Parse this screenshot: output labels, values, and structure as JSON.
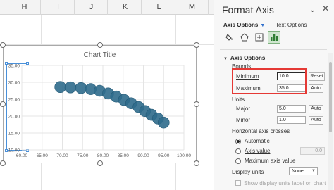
{
  "sheet": {
    "columns": [
      "H",
      "I",
      "J",
      "K",
      "L",
      "M"
    ]
  },
  "chart": {
    "title": "Chart Title"
  },
  "chart_data": {
    "type": "scatter",
    "title": "Chart Title",
    "xlabel": "",
    "ylabel": "",
    "xlim": [
      60,
      100
    ],
    "ylim": [
      10,
      35
    ],
    "x_ticks": [
      "60.00",
      "65.00",
      "70.00",
      "75.00",
      "80.00",
      "85.00",
      "90.00",
      "95.00",
      "100.00"
    ],
    "y_ticks": [
      "10.00",
      "15.00",
      "20.00",
      "25.00",
      "30.00",
      "35.00"
    ],
    "grid": true,
    "marker_color": "#2f6b8c",
    "points": [
      {
        "x": 69.5,
        "y": 28.6
      },
      {
        "x": 72.0,
        "y": 28.5
      },
      {
        "x": 74.6,
        "y": 28.3
      },
      {
        "x": 77.0,
        "y": 28.0
      },
      {
        "x": 79.2,
        "y": 27.5
      },
      {
        "x": 81.3,
        "y": 26.7
      },
      {
        "x": 83.3,
        "y": 25.8
      },
      {
        "x": 85.2,
        "y": 24.8
      },
      {
        "x": 87.0,
        "y": 23.8
      },
      {
        "x": 88.8,
        "y": 22.7
      },
      {
        "x": 90.4,
        "y": 21.5
      },
      {
        "x": 92.0,
        "y": 20.4
      },
      {
        "x": 93.6,
        "y": 19.3
      },
      {
        "x": 95.0,
        "y": 18.1
      }
    ]
  },
  "pane": {
    "title": "Format Axis",
    "tabs": [
      {
        "label": "Axis Options",
        "active": true
      },
      {
        "label": "Text Options",
        "active": false
      }
    ],
    "section": "Axis Options",
    "bounds": {
      "heading": "Bounds",
      "minimum_label": "Minimum",
      "minimum_value": "10.0",
      "minimum_button": "Reset",
      "maximum_label": "Maximum",
      "maximum_value": "35.0",
      "maximum_button": "Auto"
    },
    "units": {
      "heading": "Units",
      "major_label": "Major",
      "major_value": "5.0",
      "major_button": "Auto",
      "minor_label": "Minor",
      "minor_value": "1.0",
      "minor_button": "Auto"
    },
    "crosses": {
      "heading": "Horizontal axis crosses",
      "options": [
        "Automatic",
        "Axis value",
        "Maximum axis value"
      ],
      "selected": "Automatic",
      "axis_value": "0.0"
    },
    "display_units": {
      "label": "Display units",
      "value": "None",
      "checkbox_label": "Show display units label on chart"
    }
  },
  "colors": {
    "accent": "#2f6fcc",
    "highlight": "#e53935",
    "marker": "#2f6b8c"
  }
}
